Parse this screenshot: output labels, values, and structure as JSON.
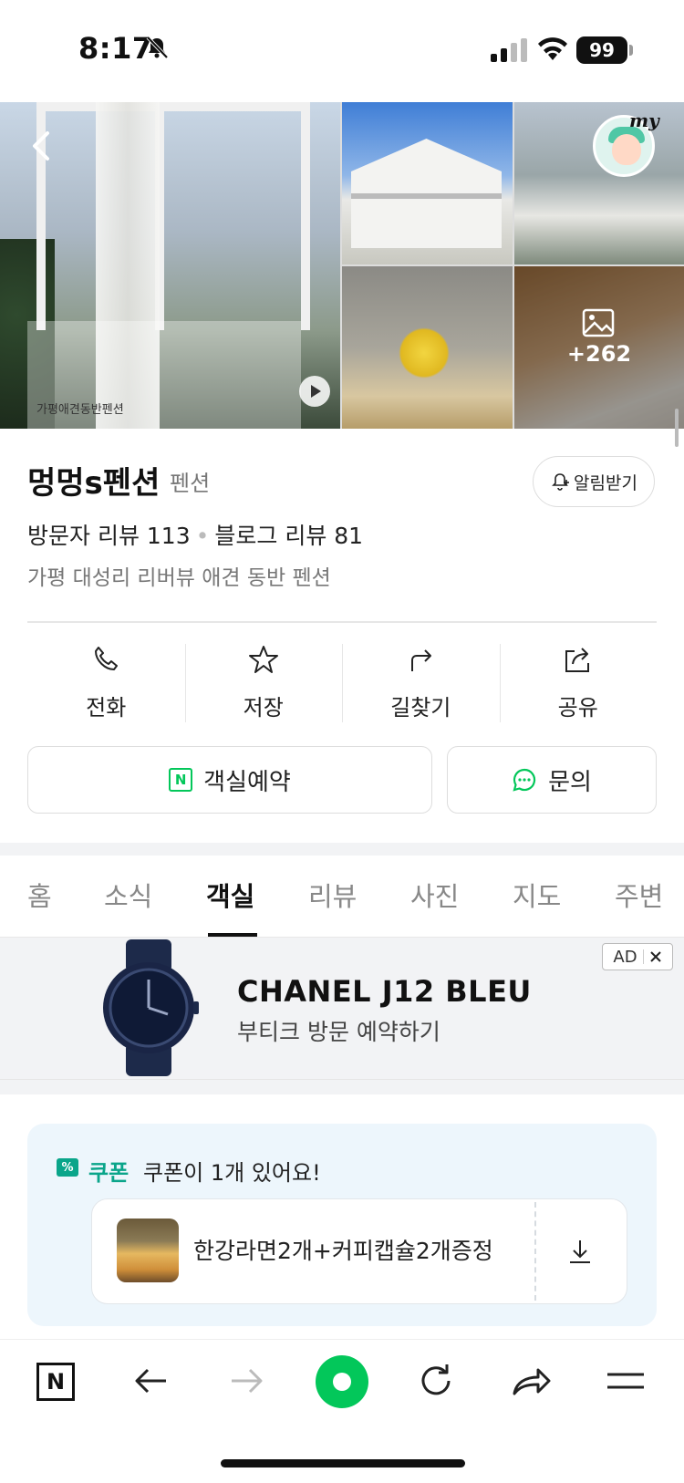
{
  "status_bar": {
    "time": "8:17",
    "battery": "99"
  },
  "gallery": {
    "main_caption": "가평애견동반펜션",
    "more_count": "+262",
    "my_label": "my"
  },
  "place": {
    "name": "멍멍s펜션",
    "category": "펜션",
    "alarm_label": "알림받기",
    "visitor_reviews": "방문자 리뷰 113",
    "blog_reviews": "블로그 리뷰 81",
    "description": "가평 대성리 리버뷰 애견 동반 펜션"
  },
  "actions": [
    {
      "label": "전화",
      "icon": "phone-icon"
    },
    {
      "label": "저장",
      "icon": "star-icon"
    },
    {
      "label": "길찾기",
      "icon": "directions-icon"
    },
    {
      "label": "공유",
      "icon": "share-icon"
    }
  ],
  "buttons": {
    "booking": "객실예약",
    "inquiry": "문의",
    "booking_badge": "N"
  },
  "tabs": [
    "홈",
    "소식",
    "객실",
    "리뷰",
    "사진",
    "지도",
    "주변"
  ],
  "active_tab": "객실",
  "ad": {
    "title": "CHANEL J12 BLEU",
    "subtitle": "부티크 방문 예약하기",
    "badge": "AD"
  },
  "coupon": {
    "tag": "쿠폰",
    "icon_text": "%",
    "message": "쿠폰이 1개 있어요!",
    "item": "한강라면2개+커피캡슐2개증정"
  },
  "toolbar": {
    "n_label": "N"
  },
  "colors": {
    "brand_green": "#03c75a",
    "coupon_green": "#0aa58a",
    "coupon_bg": "#edf6fc"
  }
}
